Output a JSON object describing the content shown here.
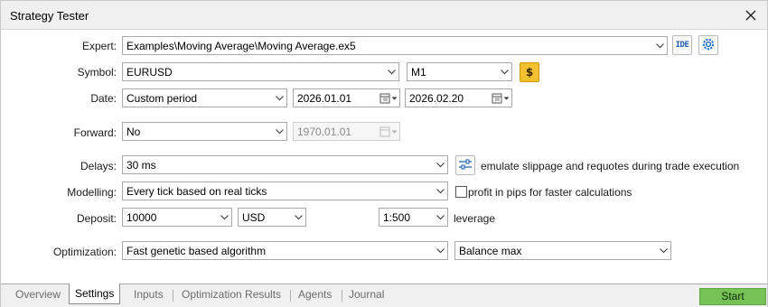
{
  "window": {
    "title": "Strategy Tester"
  },
  "labels": {
    "expert": "Expert:",
    "symbol": "Symbol:",
    "date": "Date:",
    "forward": "Forward:",
    "delays": "Delays:",
    "modelling": "Modelling:",
    "deposit": "Deposit:",
    "optimization": "Optimization:"
  },
  "fields": {
    "expert": "Examples\\Moving Average\\Moving Average.ex5",
    "symbol": "EURUSD",
    "timeframe": "M1",
    "date_mode": "Custom period",
    "date_from": "2026.01.01",
    "date_to": "2026.02.20",
    "forward": "No",
    "forward_date": "1970.01.01",
    "delays": "30 ms",
    "modelling": "Every tick based on real ticks",
    "deposit": "10000",
    "currency": "USD",
    "leverage": "1:500",
    "optimization": "Fast genetic based algorithm",
    "criterion": "Balance max"
  },
  "buttons": {
    "ide": "IDE"
  },
  "texts": {
    "emulate": "emulate slippage and requotes during trade execution",
    "profit_pips": "profit in pips for faster calculations",
    "leverage": "leverage"
  },
  "tabs": [
    "Overview",
    "Settings",
    "Inputs",
    "Optimization Results",
    "Agents",
    "Journal"
  ],
  "start_label": "Start",
  "colors": {
    "start": "#77c256",
    "accent": "#1f5fb4",
    "coin": "#f4c230"
  }
}
